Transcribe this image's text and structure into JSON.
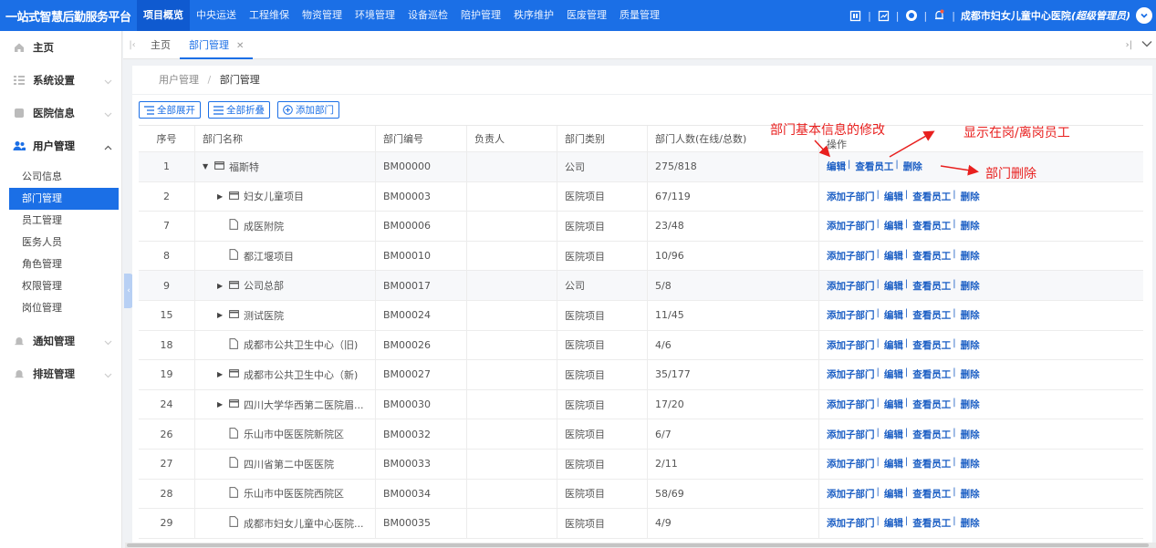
{
  "app": {
    "brand": "一站式智慧后勤服务平台",
    "nav": [
      "项目概览",
      "中央运送",
      "工程维保",
      "物资管理",
      "环境管理",
      "设备巡检",
      "陪护管理",
      "秩序维护",
      "医废管理",
      "质量管理"
    ],
    "active_nav": 0,
    "user": {
      "org": "成都市妇女儿童中心医院",
      "role": "(超级管理员)"
    }
  },
  "sidebar": {
    "menus": [
      {
        "label": "主页",
        "icon": "home-icon"
      },
      {
        "label": "系统设置",
        "icon": "grid-icon"
      },
      {
        "label": "医院信息",
        "icon": "card-icon"
      },
      {
        "label": "用户管理",
        "icon": "users-icon"
      },
      {
        "label": "通知管理",
        "icon": "bell-icon"
      },
      {
        "label": "排班管理",
        "icon": "bell-icon"
      }
    ],
    "user_mgmt_items": [
      "公司信息",
      "部门管理",
      "员工管理",
      "医务人员",
      "角色管理",
      "权限管理",
      "岗位管理"
    ],
    "active_sub": 1
  },
  "tabs": {
    "home": "主页",
    "current": "部门管理"
  },
  "breadcrumb": {
    "parent": "用户管理",
    "sep": "/",
    "current": "部门管理"
  },
  "toolbar": {
    "expand": "全部展开",
    "collapse": "全部折叠",
    "add": "添加部门"
  },
  "table": {
    "headers": [
      "序号",
      "部门名称",
      "部门编号",
      "负责人",
      "部门类别",
      "部门人数(在线/总数)",
      "操作"
    ],
    "rows": [
      {
        "no": "1",
        "name": "福斯特",
        "code": "BM00000",
        "leader": "",
        "type": "公司",
        "count": "275/818",
        "kind": "open",
        "ops": [
          "编辑",
          "查看员工",
          "删除"
        ]
      },
      {
        "no": "2",
        "name": "妇女儿童项目",
        "code": "BM00003",
        "leader": "",
        "type": "医院项目",
        "count": "67/119",
        "kind": "folder",
        "ops": [
          "添加子部门",
          "编辑",
          "查看员工",
          "删除"
        ]
      },
      {
        "no": "7",
        "name": "成医附院",
        "code": "BM00006",
        "leader": "",
        "type": "医院项目",
        "count": "23/48",
        "kind": "file",
        "ops": [
          "添加子部门",
          "编辑",
          "查看员工",
          "删除"
        ]
      },
      {
        "no": "8",
        "name": "都江堰项目",
        "code": "BM00010",
        "leader": "",
        "type": "医院项目",
        "count": "10/96",
        "kind": "file",
        "ops": [
          "添加子部门",
          "编辑",
          "查看员工",
          "删除"
        ]
      },
      {
        "no": "9",
        "name": "公司总部",
        "code": "BM00017",
        "leader": "",
        "type": "公司",
        "count": "5/8",
        "kind": "folder",
        "ops": [
          "添加子部门",
          "编辑",
          "查看员工",
          "删除"
        ]
      },
      {
        "no": "15",
        "name": "测试医院",
        "code": "BM00024",
        "leader": "",
        "type": "医院项目",
        "count": "11/45",
        "kind": "folder",
        "ops": [
          "添加子部门",
          "编辑",
          "查看员工",
          "删除"
        ]
      },
      {
        "no": "18",
        "name": "成都市公共卫生中心（旧)",
        "code": "BM00026",
        "leader": "",
        "type": "医院项目",
        "count": "4/6",
        "kind": "file",
        "ops": [
          "添加子部门",
          "编辑",
          "查看员工",
          "删除"
        ]
      },
      {
        "no": "19",
        "name": "成都市公共卫生中心（新)",
        "code": "BM00027",
        "leader": "",
        "type": "医院项目",
        "count": "35/177",
        "kind": "folder",
        "ops": [
          "添加子部门",
          "编辑",
          "查看员工",
          "删除"
        ]
      },
      {
        "no": "24",
        "name": "四川大学华西第二医院眉...",
        "code": "BM00030",
        "leader": "",
        "type": "医院项目",
        "count": "17/20",
        "kind": "folder",
        "ops": [
          "添加子部门",
          "编辑",
          "查看员工",
          "删除"
        ]
      },
      {
        "no": "26",
        "name": "乐山市中医医院新院区",
        "code": "BM00032",
        "leader": "",
        "type": "医院项目",
        "count": "6/7",
        "kind": "file",
        "ops": [
          "添加子部门",
          "编辑",
          "查看员工",
          "删除"
        ]
      },
      {
        "no": "27",
        "name": "四川省第二中医医院",
        "code": "BM00033",
        "leader": "",
        "type": "医院项目",
        "count": "2/11",
        "kind": "file",
        "ops": [
          "添加子部门",
          "编辑",
          "查看员工",
          "删除"
        ]
      },
      {
        "no": "28",
        "name": "乐山市中医医院西院区",
        "code": "BM00034",
        "leader": "",
        "type": "医院项目",
        "count": "58/69",
        "kind": "file",
        "ops": [
          "添加子部门",
          "编辑",
          "查看员工",
          "删除"
        ]
      },
      {
        "no": "29",
        "name": "成都市妇女儿童中心医院...",
        "code": "BM00035",
        "leader": "",
        "type": "医院项目",
        "count": "4/9",
        "kind": "file",
        "ops": [
          "添加子部门",
          "编辑",
          "查看员工",
          "删除"
        ]
      }
    ]
  },
  "annotations": {
    "edit": "部门基本信息的修改",
    "view": "显示在岗/离岗员工",
    "delete": "部门删除"
  },
  "colors": {
    "primary": "#1b6fe6",
    "annotation": "#e8201f"
  }
}
